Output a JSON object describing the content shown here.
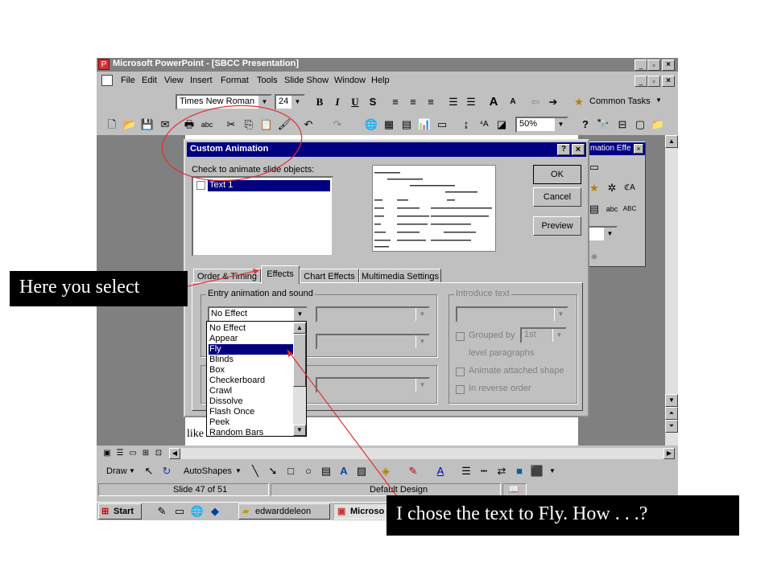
{
  "window": {
    "title": "Microsoft PowerPoint - [SBCC Presentation]",
    "controls": [
      "_",
      "□",
      "×"
    ]
  },
  "menu": [
    "File",
    "Edit",
    "View",
    "Insert",
    "Format",
    "Tools",
    "Slide Show",
    "Window",
    "Help"
  ],
  "toolbar": {
    "font_name": "Times New Roman",
    "font_size": "24",
    "zoom": "50%",
    "common_tasks": "Common Tasks"
  },
  "dialog": {
    "title": "Custom Animation",
    "help_button": "?",
    "check_label": "Check to animate slide objects:",
    "objects": [
      "Text 1"
    ],
    "ok": "OK",
    "cancel": "Cancel",
    "preview": "Preview",
    "tabs": [
      "Order & Timing",
      "Effects",
      "Chart Effects",
      "Multimedia Settings"
    ],
    "entry_group": "Entry animation and sound",
    "effect_selected": "No Effect",
    "effect_options": [
      "No Effect",
      "Appear",
      "Fly",
      "Blinds",
      "Box",
      "Checkerboard",
      "Crawl",
      "Dissolve",
      "Flash Once",
      "Peek",
      "Random Bars"
    ],
    "highlighted_option": "Fly",
    "introduce_group": "Introduce text",
    "grouped_by": "Grouped by",
    "grouped_value": "1st",
    "level_paragraphs": "level paragraphs",
    "animate_attached": "Animate attached shape",
    "reverse_order": "In reverse order"
  },
  "anim_effects_title": "mation Effe",
  "slide_text": "like",
  "drawing": {
    "draw": "Draw",
    "autoshapes": "AutoShapes"
  },
  "status": {
    "slide": "Slide 47 of 51",
    "design": "Default Design"
  },
  "taskbar": {
    "start": "Start",
    "tasks": [
      "edwarddeleon",
      "Microso"
    ]
  },
  "callouts": {
    "select": "Here you select",
    "fly": "I chose the text to Fly. How . . .?"
  }
}
